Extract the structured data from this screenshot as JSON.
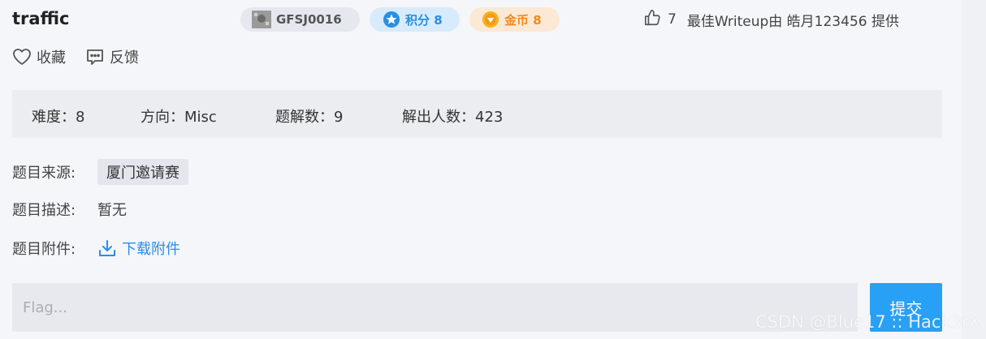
{
  "challenge": {
    "title": "traffic",
    "id_badge": "GFSJ0016",
    "score_badge": "积分 8",
    "gold_badge": "金币 8",
    "likes": "7",
    "writeup_text": "最佳Writeup由 皓月123456 提供"
  },
  "actions": {
    "favorite": "收藏",
    "feedback": "反馈"
  },
  "stats": {
    "difficulty": "难度：8",
    "direction": "方向：Misc",
    "solutions": "题解数：9",
    "solvers": "解出人数：423"
  },
  "info": {
    "source_label": "题目来源:",
    "source_value": "厦门邀请赛",
    "desc_label": "题目描述:",
    "desc_value": "暂无",
    "attach_label": "题目附件:",
    "attach_link": "下载附件"
  },
  "flag": {
    "placeholder": "Flag...",
    "submit": "提交"
  },
  "watermark": "CSDN @Blue17 :: Hack3rX",
  "colors": {
    "accent": "#27a0f5",
    "score": "#2a8fe0",
    "gold": "#f08a1c"
  },
  "icons": [
    "avatar-icon",
    "star-icon",
    "coin-icon",
    "thumbs-up-icon",
    "heart-icon",
    "feedback-icon",
    "download-icon"
  ]
}
